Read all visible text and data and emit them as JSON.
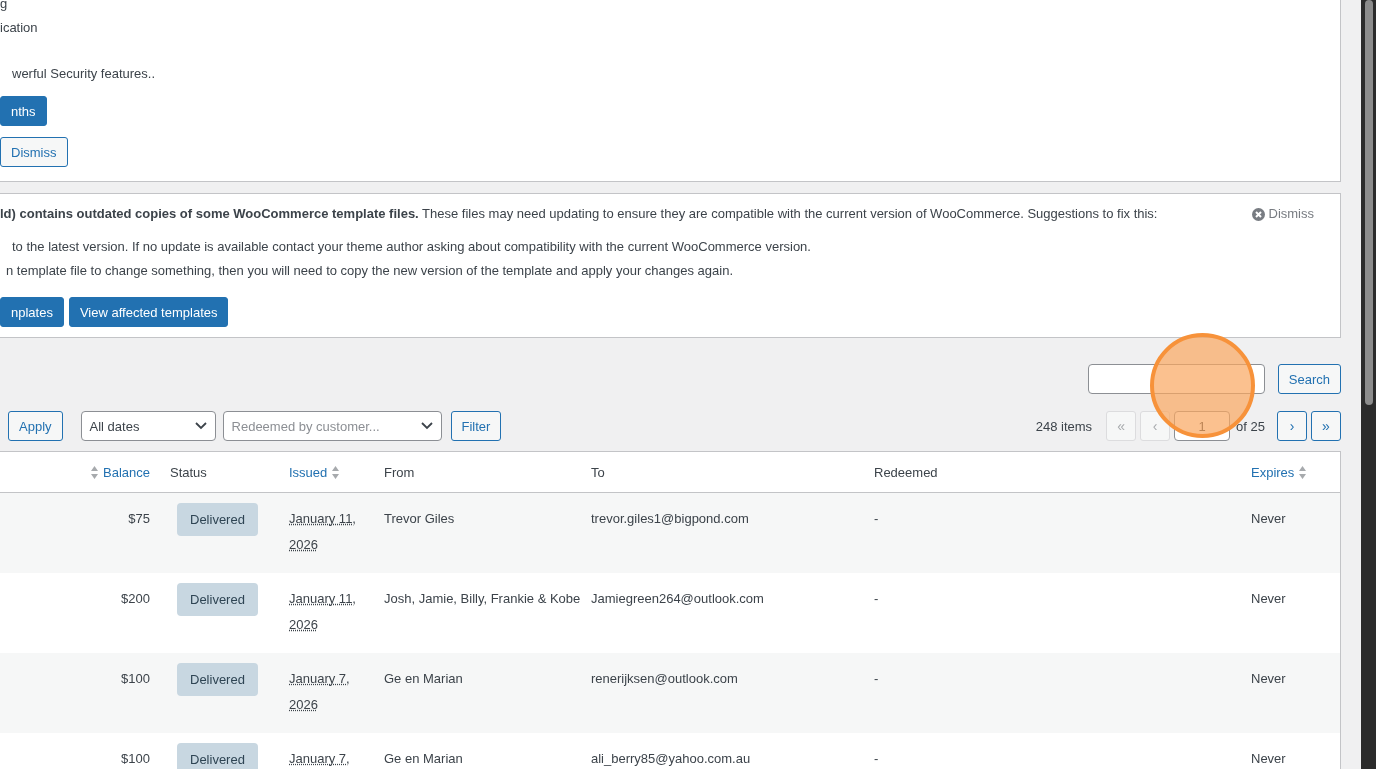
{
  "notices": [
    {
      "paragraphs": [
        [
          "g",
          "ication"
        ],
        [
          "werful Security features.."
        ]
      ],
      "buttons": [
        {
          "label": "nths",
          "kind": "primary"
        },
        {
          "label": "Dismiss",
          "kind": "secondary"
        }
      ]
    },
    {
      "dismiss": "Dismiss",
      "paragraphs": [
        [
          "**ld) contains outdated copies of some WooCommerce template files.** These files may need updating to ensure they are compatible with the current version of WooCommerce. Suggestions to fix this:"
        ],
        [
          "to the latest version. If no update is available contact your theme author asking about compatibility with the current WooCommerce version.",
          "n template file to change something, then you will need to copy the new version of the template and apply your changes again."
        ]
      ],
      "buttons": [
        {
          "label": "nplates",
          "kind": "primary"
        },
        {
          "label": "View affected templates",
          "kind": "primary"
        }
      ]
    }
  ],
  "search": {
    "button": "Search"
  },
  "tablenav": {
    "apply": "Apply",
    "date_filter": "All dates",
    "customer_filter": {
      "placeholder": "Redeemed by customer..."
    },
    "filter": "Filter",
    "count": "248 items",
    "pages": [
      {
        "label": "«",
        "disabled": true
      },
      {
        "label": "‹",
        "disabled": true
      }
    ],
    "current_page": "1",
    "total": "of 25",
    "next_pages": [
      {
        "label": "›",
        "disabled": false
      },
      {
        "label": "»",
        "disabled": false
      }
    ]
  },
  "table": {
    "columns": [
      {
        "label": "Balance",
        "sortable": true
      },
      {
        "label": "Status",
        "sortable": false
      },
      {
        "label": "Issued",
        "sortable": true
      },
      {
        "label": "From",
        "sortable": false
      },
      {
        "label": "To",
        "sortable": false
      },
      {
        "label": "Redeemed",
        "sortable": false
      },
      {
        "label": "Expires",
        "sortable": true
      }
    ],
    "rows": [
      {
        "balance": "$75",
        "status": "Delivered",
        "issued": "January 11, 2026",
        "from": "Trevor Giles",
        "to": "trevor.giles1@bigpond.com",
        "redeemed": "-",
        "expires": "Never"
      },
      {
        "balance": "$200",
        "status": "Delivered",
        "issued": "January 11, 2026",
        "from": "Josh, Jamie, Billy, Frankie & Kobe",
        "to": "Jamiegreen264@outlook.com",
        "redeemed": "-",
        "expires": "Never"
      },
      {
        "balance": "$100",
        "status": "Delivered",
        "issued": "January 7, 2026",
        "from": "Ge en Marian",
        "to": "renerijksen@outlook.com",
        "redeemed": "-",
        "expires": "Never"
      },
      {
        "balance": "$100",
        "status": "Delivered",
        "issued": "January 7,",
        "from": "Ge en Marian",
        "to": "ali_berry85@yahoo.com.au",
        "redeemed": "-",
        "expires": "Never"
      }
    ]
  }
}
